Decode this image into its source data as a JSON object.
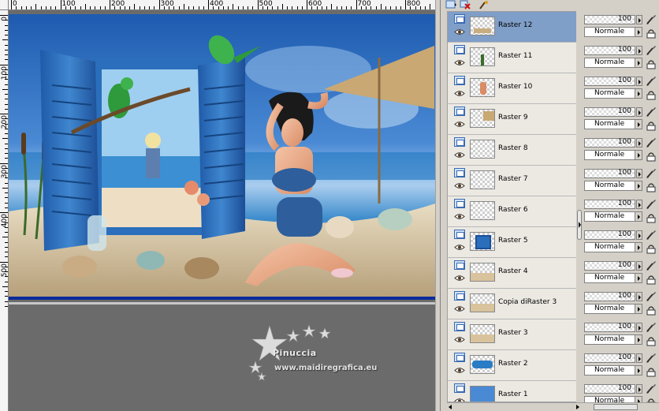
{
  "ruler": {
    "h_labels": [
      "0",
      "100",
      "200",
      "300",
      "400",
      "500",
      "600",
      "700",
      "800"
    ],
    "v_labels": [
      "0",
      "100",
      "200",
      "300",
      "400",
      "500"
    ]
  },
  "watermark": {
    "name": "Pinuccia",
    "url": "www.maidiregrafica.eu"
  },
  "layers": [
    {
      "name": "Raster 12",
      "opacity": "100",
      "blend": "Normale",
      "selected": true,
      "thumb": "sand-strip"
    },
    {
      "name": "Raster 11",
      "opacity": "100",
      "blend": "Normale",
      "selected": false,
      "thumb": "plant"
    },
    {
      "name": "Raster 10",
      "opacity": "100",
      "blend": "Normale",
      "selected": false,
      "thumb": "figure"
    },
    {
      "name": "Raster 9",
      "opacity": "100",
      "blend": "Normale",
      "selected": false,
      "thumb": "umbrella"
    },
    {
      "name": "Raster 8",
      "opacity": "100",
      "blend": "Normale",
      "selected": false,
      "thumb": "empty"
    },
    {
      "name": "Raster 7",
      "opacity": "100",
      "blend": "Normale",
      "selected": false,
      "thumb": "empty"
    },
    {
      "name": "Raster 6",
      "opacity": "100",
      "blend": "Normale",
      "selected": false,
      "thumb": "empty"
    },
    {
      "name": "Raster 5",
      "opacity": "100",
      "blend": "Normale",
      "selected": false,
      "thumb": "window"
    },
    {
      "name": "Raster 4",
      "opacity": "100",
      "blend": "Normale",
      "selected": false,
      "thumb": "sand"
    },
    {
      "name": "Copia diRaster 3",
      "opacity": "100",
      "blend": "Normale",
      "selected": false,
      "thumb": "sand"
    },
    {
      "name": "Raster 3",
      "opacity": "100",
      "blend": "Normale",
      "selected": false,
      "thumb": "sand"
    },
    {
      "name": "Raster 2",
      "opacity": "100",
      "blend": "Normale",
      "selected": false,
      "thumb": "sea"
    },
    {
      "name": "Raster 1",
      "opacity": "100",
      "blend": "Normale",
      "selected": false,
      "thumb": "sky"
    }
  ],
  "icons": {
    "toolbar": [
      "new-layer-icon",
      "delete-layer-icon",
      "properties-icon"
    ],
    "row_left": [
      "layer-type-icon",
      "visibility-eye-icon"
    ],
    "row_right": [
      "brush-icon",
      "lock-icon"
    ]
  },
  "colors": {
    "selected_row": "#7f9ec8",
    "canvas_bg": "#6b6b6b",
    "image_border": "#0a2a9a"
  }
}
